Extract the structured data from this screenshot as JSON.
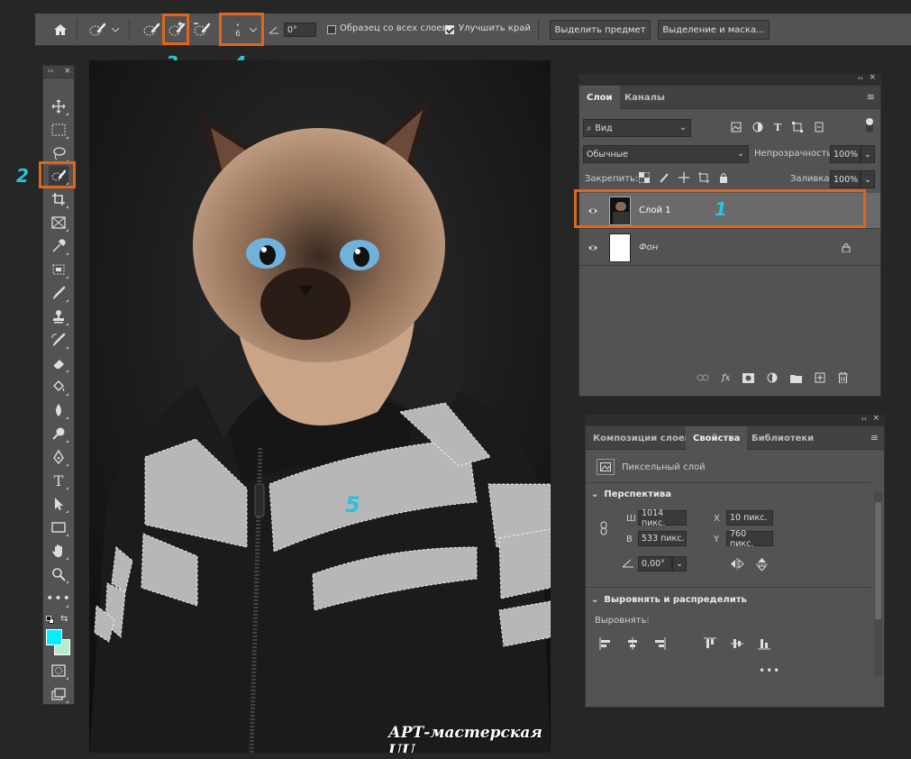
{
  "options_bar": {
    "sample_all_layers": "Образец со всех слоев",
    "enhance_edge": "Улучшить край",
    "brush_size": "6",
    "angle": "0°",
    "select_subject": "Выделить предмет",
    "select_and_mask": "Выделение и маска..."
  },
  "annotations": {
    "n1": "1",
    "n2": "2",
    "n3": "3",
    "n4": "4",
    "n5": "5"
  },
  "watermark": "АРТ-мастерская UU",
  "layers_panel": {
    "tabs": [
      "Слои",
      "Каналы"
    ],
    "filter": "Вид",
    "blend_mode": "Обычные",
    "opacity_label": "Непрозрачность:",
    "opacity_value": "100%",
    "lock_label": "Закрепить:",
    "fill_label": "Заливка:",
    "fill_value": "100%",
    "layers": [
      {
        "name": "Слой 1",
        "selected": true
      },
      {
        "name": "Фон",
        "locked": true
      }
    ]
  },
  "properties_panel": {
    "tabs": [
      "Композиции слоев",
      "Свойства",
      "Библиотеки"
    ],
    "layer_type": "Пиксельный слой",
    "transform_section": "Перспектива",
    "w_label": "Ш",
    "w_value": "1014 пикс.",
    "x_label": "X",
    "x_value": "10 пикс.",
    "h_label": "В",
    "h_value": "533 пикс.",
    "y_label": "Y",
    "y_value": "760 пикс.",
    "angle_value": "0,00°",
    "align_section": "Выровнять и распределить",
    "align_label": "Выровнять:"
  },
  "colors": {
    "foreground": "#00f0ff",
    "background": "#b5ecc9",
    "accent_highlight": "#e0661c",
    "annotation": "#2ac3dd"
  }
}
